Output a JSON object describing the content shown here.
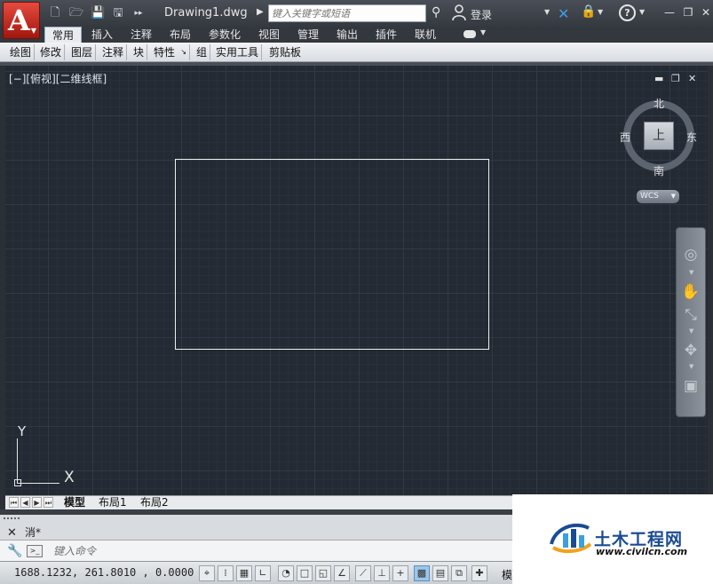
{
  "title_bar": {
    "document_title": "Drawing1.dwg",
    "search_placeholder": "键入关键字或短语",
    "login_label": "登录",
    "overflow_glyph": "▸▸"
  },
  "ribbon": {
    "tabs": [
      "常用",
      "插入",
      "注释",
      "布局",
      "参数化",
      "视图",
      "管理",
      "输出",
      "插件",
      "联机"
    ],
    "active_tab": "常用",
    "panels": [
      "绘图",
      "修改",
      "图层",
      "注释",
      "块",
      "特性",
      "组",
      "实用工具",
      "剪贴板"
    ]
  },
  "viewport": {
    "label": "[−][俯视][二维线框]",
    "compass": {
      "north": "北",
      "south": "南",
      "east": "东",
      "west": "西"
    },
    "viewcube_face": "上",
    "wcs_label": "WCS",
    "ucs_x": "X",
    "ucs_y": "Y"
  },
  "layout_tabs": [
    "模型",
    "布局1",
    "布局2"
  ],
  "command": {
    "history_text": "消*",
    "input_placeholder": "键入命令"
  },
  "status_bar": {
    "coordinates": "1688.1232, 261.8010 , 0.0000",
    "model_label": "模型"
  },
  "watermark": {
    "name_cn": "土木工程网",
    "url": "www.civilcn.com"
  },
  "colors": {
    "canvas_bg": "#242a33",
    "app_button_red": "#c22a1e",
    "active_status_blue": "#9cc6ea",
    "watermark_blue": "#1a4b93"
  }
}
